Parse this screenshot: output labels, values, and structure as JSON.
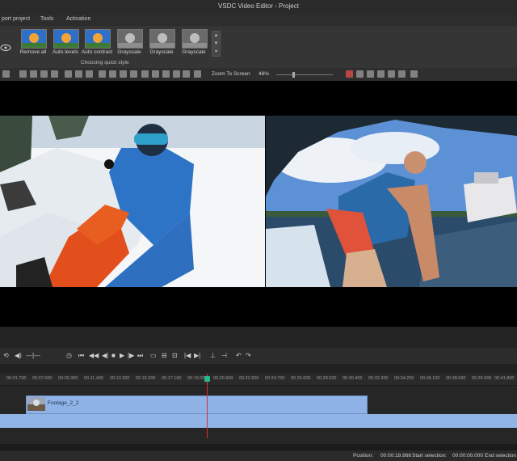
{
  "window": {
    "title": "VSDC Video Editor - Project"
  },
  "menu": {
    "items": [
      "port project",
      "Tools",
      "Activation"
    ]
  },
  "ribbon": {
    "quick_styles": [
      {
        "label": "Remove all",
        "tone": "color"
      },
      {
        "label": "Auto levels",
        "tone": "color"
      },
      {
        "label": "Auto contrast",
        "tone": "color"
      },
      {
        "label": "Grayscale",
        "tone": "gray"
      },
      {
        "label": "Grayscale",
        "tone": "gray"
      },
      {
        "label": "Grayscale",
        "tone": "gray"
      }
    ],
    "group_label": "Choosing quick style"
  },
  "toolbar": {
    "zoom_mode": "Zoom To Screen",
    "zoom_percent": "48%"
  },
  "timeline": {
    "ruler_ticks": [
      "00:01.700",
      "00:07.600",
      "00:09.300",
      "00:11.400",
      "00:13.300",
      "00:15.200",
      "00:17.100",
      "00:19.000",
      "00:20.900",
      "00:22.800",
      "00:24.700",
      "00:26.600",
      "00:28.500",
      "00:30.400",
      "00:32.300",
      "00:34.200",
      "00:36.100",
      "00:38.000",
      "00:39.900",
      "00:41.800"
    ],
    "clip_name": "Footage_2_2",
    "playhead_position": "00:00:19.866"
  },
  "status": {
    "position_label": "Position:",
    "position_value": "00:00:19.866",
    "start_label": "Start selection:",
    "start_value": "00:00:00.000",
    "end_label": "End selection"
  },
  "colors": {
    "clip": "#8fb3e6",
    "playhead": "#e03030",
    "playhead_marker": "#2ab58c"
  }
}
